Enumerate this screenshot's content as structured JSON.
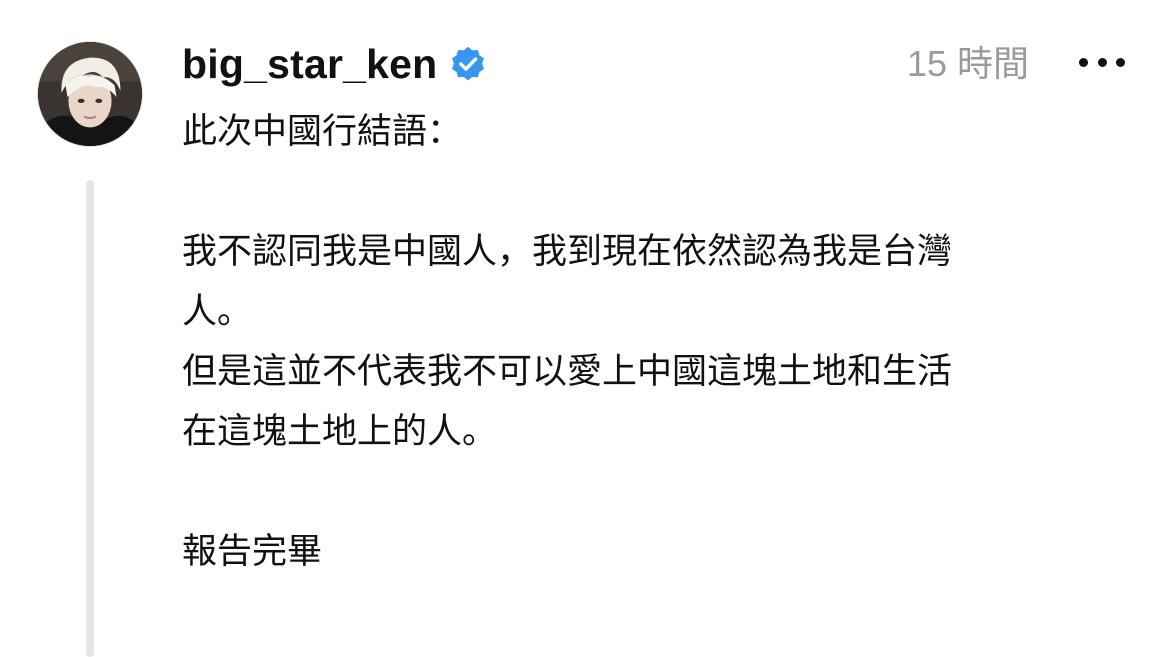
{
  "post": {
    "username": "big_star_ken",
    "verified": true,
    "timestamp": "15 時間",
    "more_icon": "more-horizontal-icon",
    "avatar_icon": "user-avatar-photo",
    "verified_color": "#3797f0",
    "body": {
      "line1": "此次中國行結語：",
      "line2": "我不認同我是中國人，我到現在依然認為我是台灣",
      "line3": "人。",
      "line4": "但是這並不代表我不可以愛上中國這塊土地和生活",
      "line5": "在這塊土地上的人。",
      "line6": "報告完畢"
    }
  }
}
